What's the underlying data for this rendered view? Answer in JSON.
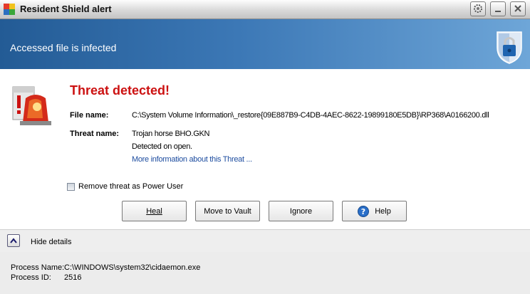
{
  "window": {
    "title": "Resident Shield alert",
    "controls": [
      "gear-icon",
      "minimize-icon",
      "close-icon"
    ]
  },
  "banner": {
    "text": "Accessed file is infected",
    "icon": "shield-lock-icon"
  },
  "alert": {
    "heading": "Threat detected!",
    "icon": "alarm-icon",
    "file_label": "File name:",
    "file_value": "C:\\System Volume Information\\_restore{09E887B9-C4DB-4AEC-8622-19899180E5DB}\\RP368\\A0166200.dll",
    "threat_label": "Threat name:",
    "threat_value": "Trojan horse BHO.GKN",
    "detected_text": "Detected on open.",
    "more_info_link": "More information about this Threat ..."
  },
  "options": {
    "remove_checkbox_label": "Remove threat as Power User",
    "remove_checked": false
  },
  "buttons": {
    "heal": "Heal",
    "move": "Move to Vault",
    "ignore": "Ignore",
    "help": "Help"
  },
  "details": {
    "toggle_label": "Hide details",
    "toggle_icon": "chevron-up-icon",
    "process_name_label": "Process Name:",
    "process_name_value": "C:\\WINDOWS\\system32\\cidaemon.exe",
    "process_id_label": "Process ID:",
    "process_id_value": "2516"
  },
  "colors": {
    "heading": "#cc1111",
    "banner_start": "#235b95",
    "banner_end": "#6ea6d8",
    "link": "#1f4ea0"
  }
}
